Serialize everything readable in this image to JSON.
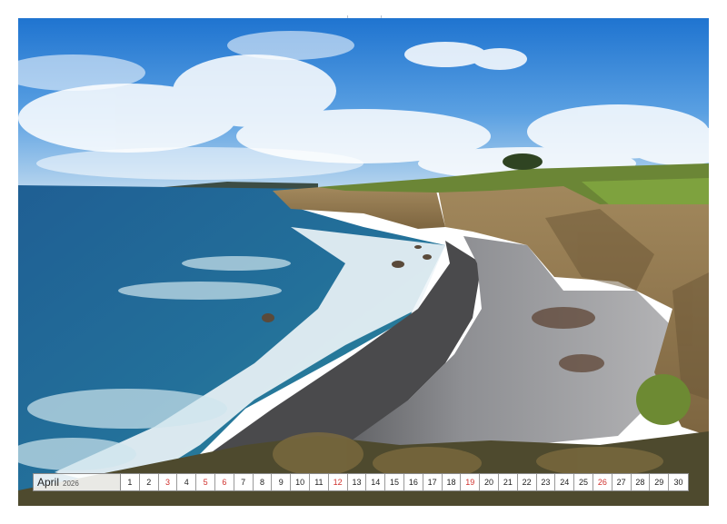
{
  "calendar": {
    "month": "April",
    "year": "2026",
    "days": [
      {
        "label": "1",
        "red": false
      },
      {
        "label": "2",
        "red": false
      },
      {
        "label": "3",
        "red": true
      },
      {
        "label": "4",
        "red": false
      },
      {
        "label": "5",
        "red": true
      },
      {
        "label": "6",
        "red": true
      },
      {
        "label": "7",
        "red": false
      },
      {
        "label": "8",
        "red": false
      },
      {
        "label": "9",
        "red": false
      },
      {
        "label": "10",
        "red": false
      },
      {
        "label": "11",
        "red": false
      },
      {
        "label": "12",
        "red": true
      },
      {
        "label": "13",
        "red": false
      },
      {
        "label": "14",
        "red": false
      },
      {
        "label": "15",
        "red": false
      },
      {
        "label": "16",
        "red": false
      },
      {
        "label": "17",
        "red": false
      },
      {
        "label": "18",
        "red": false
      },
      {
        "label": "19",
        "red": true
      },
      {
        "label": "20",
        "red": false
      },
      {
        "label": "21",
        "red": false
      },
      {
        "label": "22",
        "red": false
      },
      {
        "label": "23",
        "red": false
      },
      {
        "label": "24",
        "red": false
      },
      {
        "label": "25",
        "red": false
      },
      {
        "label": "26",
        "red": true
      },
      {
        "label": "27",
        "red": false
      },
      {
        "label": "28",
        "red": false
      },
      {
        "label": "29",
        "red": false
      },
      {
        "label": "30",
        "red": false
      }
    ],
    "colors": {
      "weekday": "#222222",
      "holiday": "#d0312d"
    }
  },
  "photo": {
    "subject": "rocky coastline with pebble beach",
    "colors": {
      "sky": "#3b86d6",
      "sea": "#1f5f8a",
      "surf": "#e9f2f6",
      "pebbles": "#9a9a9a",
      "cliff": "#b89a6a",
      "grass": "#6f8f3a"
    }
  }
}
